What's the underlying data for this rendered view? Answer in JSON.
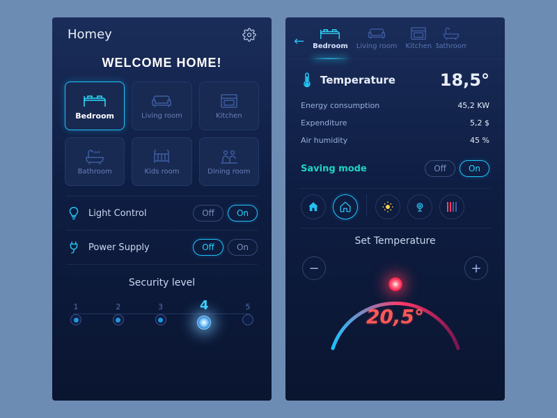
{
  "screen1": {
    "app_title": "Homey",
    "welcome": "WELCOME HOME!",
    "rooms": [
      {
        "label": "Bedroom",
        "active": true
      },
      {
        "label": "Living room"
      },
      {
        "label": "Kitchen"
      },
      {
        "label": "Bathroom"
      },
      {
        "label": "Kids room"
      },
      {
        "label": "Dining room"
      }
    ],
    "light_control": {
      "label": "Light Control",
      "off": "Off",
      "on": "On",
      "state": "on"
    },
    "power_supply": {
      "label": "Power Supply",
      "off": "Off",
      "on": "On",
      "state": "off"
    },
    "security": {
      "label": "Security level",
      "levels": [
        "1",
        "2",
        "3",
        "4",
        "5"
      ],
      "active": 4
    }
  },
  "screen2": {
    "tabs": [
      {
        "label": "Bedroom",
        "active": true
      },
      {
        "label": "Living room"
      },
      {
        "label": "Kitchen"
      },
      {
        "label": "Bathroom"
      }
    ],
    "temperature": {
      "label": "Temperature",
      "value": "18,5°"
    },
    "stats": [
      {
        "k": "Energy consumption",
        "v": "45,2 KW"
      },
      {
        "k": "Expenditure",
        "v": "5,2 $"
      },
      {
        "k": "Air humidity",
        "v": "45 %"
      }
    ],
    "saving": {
      "label": "Saving mode",
      "off": "Off",
      "on": "On",
      "state": "on"
    },
    "set_temperature": {
      "label": "Set Temperature",
      "value": "20,5°"
    }
  }
}
